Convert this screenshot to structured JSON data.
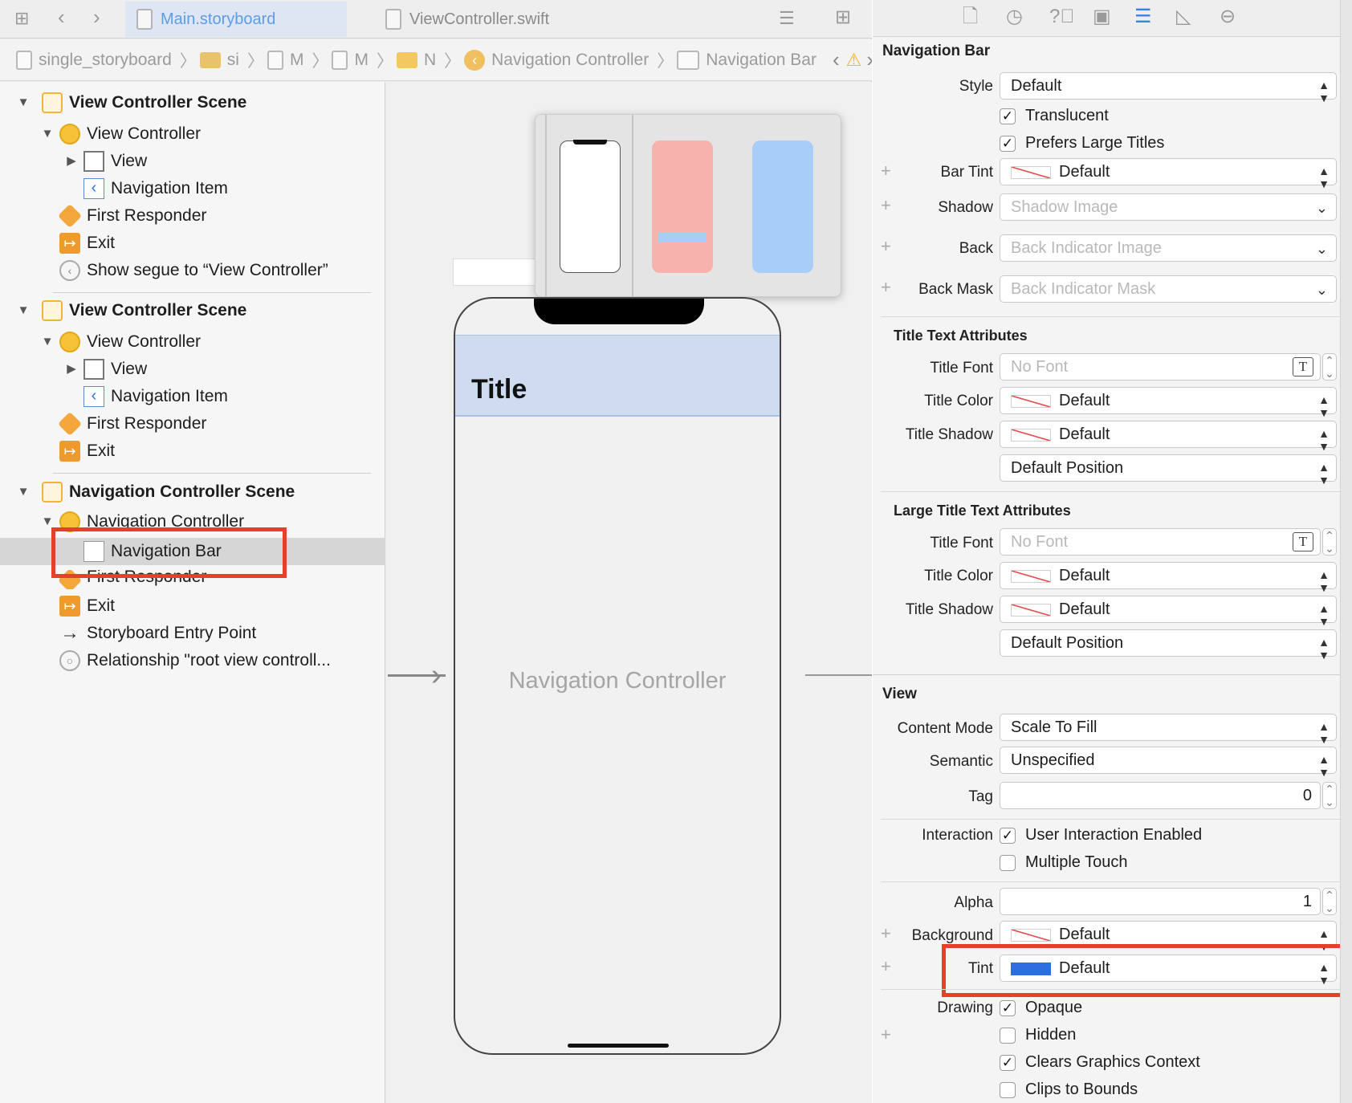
{
  "tabs": {
    "active": "Main.storyboard",
    "inactive": "ViewController.swift"
  },
  "jumpbar": {
    "project": "single_storyboard",
    "group": "si",
    "file1": "M",
    "file2": "M",
    "file3": "N",
    "scene": "Navigation Controller",
    "element": "Navigation Bar"
  },
  "outline": {
    "scene1": {
      "title": "View Controller Scene",
      "vc": "View Controller",
      "view": "View",
      "navitem": "Navigation Item",
      "fr": "First Responder",
      "exit": "Exit",
      "segue": "Show segue to “View Controller”"
    },
    "scene2": {
      "title": "View Controller Scene",
      "vc": "View Controller",
      "view": "View",
      "navitem": "Navigation Item",
      "fr": "First Responder",
      "exit": "Exit"
    },
    "scene3": {
      "title": "Navigation Controller Scene",
      "nc": "Navigation Controller",
      "navbar": "Navigation Bar",
      "fr": "First Responder",
      "exit": "Exit",
      "entry": "Storyboard Entry Point",
      "relationship": "Relationship \"root view controll..."
    }
  },
  "canvas": {
    "nav_title": "Title",
    "controller_label": "Navigation Controller"
  },
  "inspector": {
    "navbar": {
      "header": "Navigation Bar",
      "style_label": "Style",
      "style_value": "Default",
      "translucent": "Translucent",
      "prefers_large": "Prefers Large Titles",
      "bartint_label": "Bar Tint",
      "bartint_value": "Default",
      "shadow_label": "Shadow",
      "shadow_ph": "Shadow Image",
      "back_label": "Back",
      "back_ph": "Back Indicator Image",
      "backmask_label": "Back Mask",
      "backmask_ph": "Back Indicator Mask"
    },
    "title_attrs": {
      "header": "Title Text Attributes",
      "font_label": "Title Font",
      "font_ph": "No Font",
      "color_label": "Title Color",
      "color_value": "Default",
      "shadow_label": "Title Shadow",
      "shadow_value": "Default",
      "position_value": "Default Position"
    },
    "large_title_attrs": {
      "header": "Large Title Text Attributes",
      "font_label": "Title Font",
      "font_ph": "No Font",
      "color_label": "Title Color",
      "color_value": "Default",
      "shadow_label": "Title Shadow",
      "shadow_value": "Default",
      "position_value": "Default Position"
    },
    "view": {
      "header": "View",
      "content_mode_label": "Content Mode",
      "content_mode_value": "Scale To Fill",
      "semantic_label": "Semantic",
      "semantic_value": "Unspecified",
      "tag_label": "Tag",
      "tag_value": "0",
      "interaction_label": "Interaction",
      "user_interaction": "User Interaction Enabled",
      "multiple_touch": "Multiple Touch",
      "alpha_label": "Alpha",
      "alpha_value": "1",
      "background_label": "Background",
      "background_value": "Default",
      "tint_label": "Tint",
      "tint_value": "Default",
      "drawing_label": "Drawing",
      "opaque": "Opaque",
      "hidden": "Hidden",
      "clears": "Clears Graphics Context",
      "clips": "Clips to Bounds"
    }
  },
  "checkbox_states": {
    "translucent": true,
    "prefers_large": true,
    "user_interaction": true,
    "multiple_touch": false,
    "opaque": true,
    "hidden": false,
    "clears": true,
    "clips": false
  },
  "colors": {
    "highlight_box": "#e5402a",
    "tint_swatch": "#2b6fe0",
    "nav_bar_fill": "#cfdcf0",
    "active_tab": "#5d9ce6",
    "preview_pink": "#f8b2ad",
    "preview_blue": "#a8cdf7"
  }
}
